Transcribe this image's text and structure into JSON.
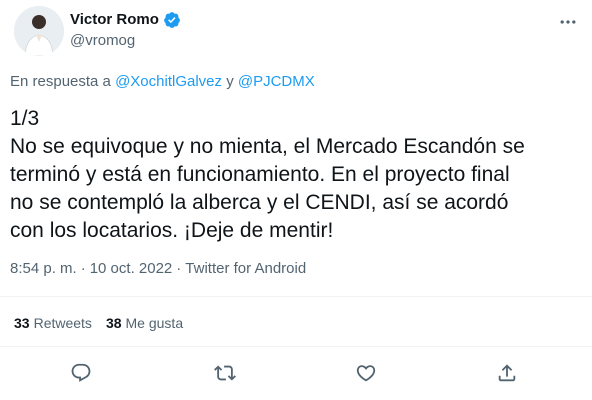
{
  "author": {
    "name": "Victor Romo",
    "handle": "@vromog",
    "verified_icon": "verified-badge-icon",
    "avatar_bg": "#e9eef2"
  },
  "reply": {
    "prefix": "En respuesta a",
    "users": [
      "@XochitlGalvez",
      "@PJCDMX"
    ],
    "joiner": "y"
  },
  "tweet": {
    "lines": [
      "1/3",
      "No se equivoque y no mienta, el Mercado Escandón se",
      "terminó y está en funcionamiento. En el proyecto final",
      "no se contempló la alberca y el CENDI, así se acordó",
      "con los locatarios. ¡Deje de mentir!"
    ]
  },
  "meta": {
    "time": "8:54 p. m.",
    "separator": "·",
    "date": "10 oct. 2022",
    "source": "Twitter for Android"
  },
  "stats": {
    "retweets_count": "33",
    "retweets_label": "Retweets",
    "likes_count": "38",
    "likes_label": "Me gusta"
  },
  "actions": [
    "reply-icon",
    "retweet-icon",
    "like-icon",
    "share-icon"
  ],
  "colors": {
    "accent": "#1d9bf0",
    "text": "#0f1419",
    "secondary": "#536471",
    "divider": "#eff3f4"
  }
}
